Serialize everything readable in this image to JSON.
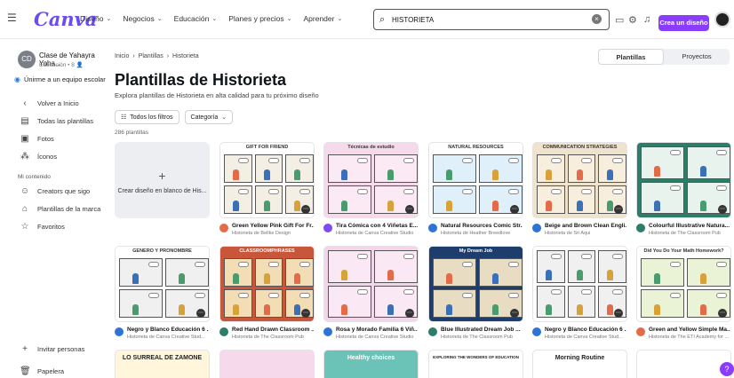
{
  "app": {
    "logo": "Canva"
  },
  "nav": [
    "Diseño",
    "Negocios",
    "Educación",
    "Planes y precios",
    "Aprender"
  ],
  "search": {
    "value": "HISTORIETA"
  },
  "header_cta": "Crea un diseño",
  "sidebar": {
    "team_initials": "CD",
    "team_name": "Clase de Yahayra Yoha...",
    "team_sub": "Educación • 8 👤",
    "join": "Únirme a un equipo escolar",
    "items_top": [
      {
        "icon": "chevron-left-icon",
        "glyph": "‹",
        "label": "Volver a Inicio"
      },
      {
        "icon": "templates-icon",
        "glyph": "▤",
        "label": "Todas las plantillas"
      },
      {
        "icon": "photo-icon",
        "glyph": "▣",
        "label": "Fotos"
      },
      {
        "icon": "shapes-icon",
        "glyph": "⁂",
        "label": "Íconos"
      }
    ],
    "section": "Mi contenido",
    "items_content": [
      {
        "icon": "creators-icon",
        "glyph": "☺",
        "label": "Creators que sigo"
      },
      {
        "icon": "brand-icon",
        "glyph": "⌂",
        "label": "Plantillas de la marca"
      },
      {
        "icon": "star-icon",
        "glyph": "☆",
        "label": "Favoritos"
      }
    ],
    "invite": "Invitar personas",
    "trash": "Papelera"
  },
  "breadcrumb": [
    "Inicio",
    "Plantillas",
    "Historieta"
  ],
  "tabs": [
    "Plantillas",
    "Proyectos"
  ],
  "page_title": "Plantillas de Historieta",
  "page_sub": "Explora plantillas de Historieta en alta calidad para tu próximo diseño",
  "filters": {
    "all": "Todos los filtros",
    "category": "Categoría"
  },
  "count": "286 plantillas",
  "blank_card": {
    "label": "Crear diseño en blanco de His..."
  },
  "cards": [
    {
      "name": "Green Yellow Pink Gift For Fr...",
      "author": "Historieta de Bellke Design",
      "bg": "#ffffff",
      "bar": "#ffffff",
      "heading": "GIFT FOR FRIEND",
      "avatar": "#e46b4a",
      "panel": "#f3efe4"
    },
    {
      "name": "Tira Cómica con 4 Viñetas E...",
      "author": "Historieta de Canva Creative Studio",
      "bg": "#f6d9ea",
      "bar": "#f6d9ea",
      "heading": "Técnicas de estudio",
      "avatar": "#7d4cf0",
      "panel": "#fbe9f3"
    },
    {
      "name": "Natural Resources Comic Str...",
      "author": "Historieta de Heather Breedlove",
      "bg": "#ffffff",
      "bar": "#ffffff",
      "heading": "NATURAL RESOURCES",
      "avatar": "#2d74d6",
      "panel": "#dff0fa"
    },
    {
      "name": "Beige and Brown Clean Engli...",
      "author": "Historieta de Sri Aqui",
      "bg": "#efe3cd",
      "bar": "#efe3cd",
      "heading": "COMMUNICATION STRATEGIES",
      "avatar": "#2d74d6",
      "panel": "#f7eedd"
    },
    {
      "name": "Colourful Illustrative Natura...",
      "author": "Historieta de The Classroom Pub",
      "bg": "#2e7c6a",
      "bar": "#2e7c6a",
      "heading": "",
      "avatar": "#2e7c6a",
      "panel": "#e9f3ee"
    },
    {
      "name": "Negro y Blanco Educación 6 ...",
      "author": "Historieta de Canva Creative Stud...",
      "bg": "#ffffff",
      "bar": "#ffffff",
      "heading": "GENERO Y PRONOMBRE",
      "avatar": "#2d74d6",
      "panel": "#f0f0f0"
    },
    {
      "name": "Red Hand Drawn Classroom ...",
      "author": "Historieta de The Classroom Pub",
      "bg": "#c7563a",
      "bar": "#c7563a",
      "heading": "CLASSROOMPHRASES",
      "avatar": "#2e7c6a",
      "panel": "#f3ddb5"
    },
    {
      "name": "Rosa y Morado Familia 6 Viñ...",
      "author": "Historieta de Canva Creative Studio",
      "bg": "#f3d6ea",
      "bar": "#f3d6ea",
      "heading": "",
      "avatar": "#2d74d6",
      "panel": "#fae8f4"
    },
    {
      "name": "Blue Illustrated Dream Job ...",
      "author": "Historieta de The Classroom Pub",
      "bg": "#1d3d6d",
      "bar": "#1d3d6d",
      "heading": "My Dream Job",
      "avatar": "#2e7c6a",
      "panel": "#e8dcc2"
    },
    {
      "name": "Negro y Blanco Educación 6 ...",
      "author": "Historieta de Canva Creative Stud...",
      "bg": "#ffffff",
      "bar": "#ffffff",
      "heading": "",
      "avatar": "#2d74d6",
      "panel": "#f0f0f0"
    },
    {
      "name": "Green and Yellow Simple Ma...",
      "author": "Historieta de The ETI Academy for ...",
      "bg": "#ffffff",
      "bar": "#ffffff",
      "heading": "Did You Do Your Math Homework?",
      "avatar": "#e46b4a",
      "panel": "#eaf3d6"
    }
  ],
  "bottom_row": [
    {
      "heading": "LO SURREAL DE ZAMONE",
      "bg": "#fff6dc"
    },
    {
      "heading": "",
      "bg": "#f6d9ea"
    },
    {
      "heading": "Healthy choices",
      "bg": "#6bc3b8"
    },
    {
      "heading": "EXPLORING THE WONDERS OF EDUCATION",
      "bg": "#ffffff"
    },
    {
      "heading": "Morning Routine",
      "bg": "#ffffff"
    },
    {
      "heading": "",
      "bg": "#ffffff"
    }
  ],
  "help": "?"
}
